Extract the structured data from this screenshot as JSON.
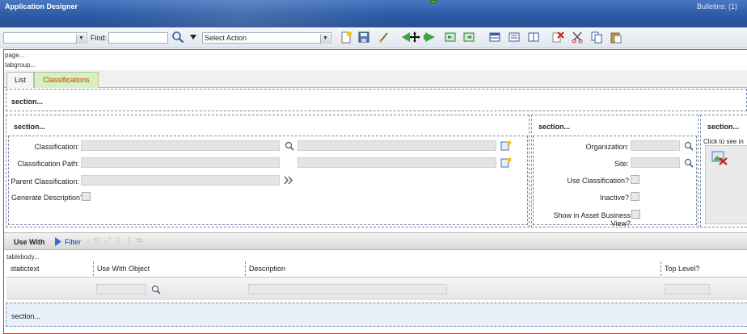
{
  "titlebar": {
    "app_name": "Application Designer",
    "bulletins": "Bulletins: (1)"
  },
  "toolbar": {
    "app_dropdown_value": "",
    "find_label": "Find:",
    "find_value": "",
    "action_select": "Select Action",
    "icons": [
      "new-icon",
      "save-icon",
      "clear-icon",
      "move-icon",
      "prev-icon",
      "next-icon",
      "import-icon",
      "export-icon",
      "grid-icon",
      "list-icon",
      "columns-icon",
      "delete-icon",
      "cut-icon",
      "copy-icon",
      "paste-icon"
    ]
  },
  "canvas": {
    "page_label": "page...",
    "tabgroup_label": "tabgroup..."
  },
  "tabs": [
    {
      "label": "List"
    },
    {
      "label": "Classifications"
    }
  ],
  "sections": {
    "top": "section...",
    "left": "section...",
    "middle": "section...",
    "right": "section...",
    "bottom": "section..."
  },
  "fields": {
    "classification": "Classification:",
    "classification_path": "Classification Path:",
    "parent_classification": "Parent Classification:",
    "generate_description": "Generate Description?",
    "organization": "Organization:",
    "site": "Site:",
    "use_classification": "Use Classification?",
    "inactive": "Inactive?",
    "show_asset_business_view": "Show in Asset Business View?"
  },
  "image_panel": {
    "text": "Click to see in"
  },
  "table": {
    "title": "Use With",
    "filter_label": "Filter",
    "body_label": "tablebody...",
    "columns": [
      "statictext",
      "Use With Object",
      "Description",
      "Top Level?"
    ]
  }
}
